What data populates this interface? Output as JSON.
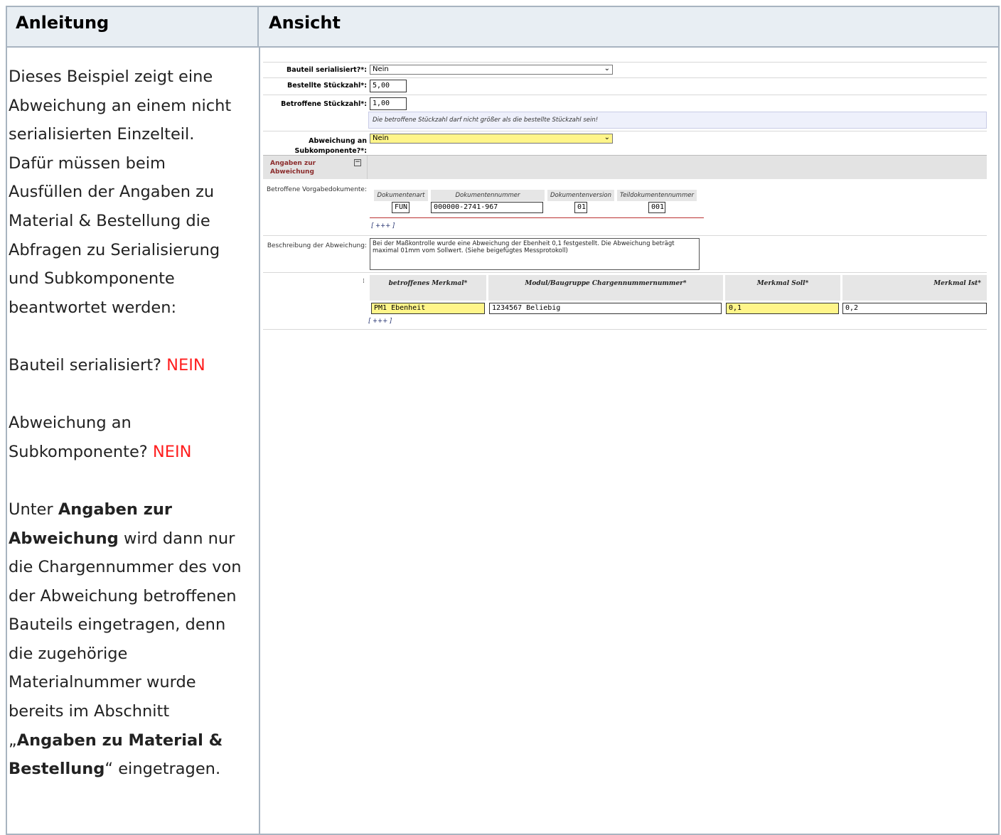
{
  "header": {
    "left_title": "Anleitung",
    "right_title": "Ansicht"
  },
  "instructions": {
    "intro": "Dieses Beispiel zeigt eine Abweichung an einem nicht serialisierten Einzelteil. Dafür müssen beim Ausfüllen der Angaben zu Material & Bestellung die Abfragen zu Serialisierung und Subkomponente beantwortet werden:",
    "q1_text": "Bauteil serialisiert?",
    "q1_answer": "NEIN",
    "q2_text": "Abweichung an Subkomponente?",
    "q2_answer": "NEIN",
    "p3_pre": "Unter",
    "p3_bold": "Angaben zur Abweichung",
    "p3_rest": "wird dann nur die Chargennummer des von der Abweichung betroffenen Bauteils eingetragen, denn die zugehörige Materialnummer wurde bereits im Abschnitt",
    "p3_quote_open": "„",
    "p3_bold2": "Angaben zu Material & Bestellung",
    "p3_quote_close": "“",
    "p3_end": "eingetragen."
  },
  "form": {
    "serialized_label": "Bauteil serialisiert?*:",
    "serialized_value": "Nein",
    "ordered_qty_label": "Bestellte Stückzahl*:",
    "ordered_qty_value": "5,00",
    "affected_qty_label": "Betroffene Stückzahl*:",
    "affected_qty_value": "1,00",
    "hint_text": "Die betroffene Stückzahl darf nicht größer als die bestellte Stückzahl sein!",
    "subcomponent_label_1": "Abweichung an",
    "subcomponent_label_2": "Subkomponente?*:",
    "subcomponent_value": "Nein",
    "section_title": "Angaben zur Abweichung",
    "docs_label": "Betroffene Vorgabedokumente:",
    "doc_columns": [
      "Dokumentenart",
      "Dokumentennummer",
      "Dokumentenversion",
      "Teildokumentennummer"
    ],
    "doc_values": [
      "FUN",
      "000000-2741-967",
      "01",
      "001"
    ],
    "add_link": "[ +++ ]",
    "desc_label": "Beschreibung der Abweichung:",
    "desc_value": "Bei der Maßkontrolle wurde eine Abweichung der Ebenheit 0,1 festgestellt. Die Abweichung beträgt maximal 01mm vom Sollwert. (Siehe beigefügtes Messprotokoll)",
    "grid_columns": [
      "betroffenes Merkmal*",
      "Modul/Baugruppe Chargennummernummer*",
      "Merkmal Soll*",
      "Merkmal Ist*"
    ],
    "grid_values": [
      "PM1 Ebenheit",
      "1234567 Beliebig",
      "0,1",
      "0,2"
    ],
    "grid_add_link": "[ +++ ]"
  },
  "colors": {
    "accent_red": "#ff1e1e",
    "field_yellow": "#fff58a",
    "header_bg": "#e8eef3"
  }
}
